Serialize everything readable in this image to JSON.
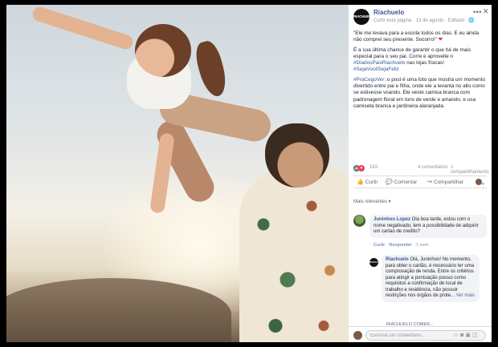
{
  "photo": {},
  "header": {
    "logo_text": "RIACHUELO",
    "page_name": "Riachuelo",
    "meta": "Curtir esta página · 13 de agosto · Editado · 🌐",
    "more_icon": "more-dots-icon",
    "close_icon": "close-icon"
  },
  "post": {
    "p1": "\"Ele me levava para a escola todos os dias. E eu ainda não comprei seu presente. Socorro!\"",
    "p2_a": "É a sua última chance de garantir o que há de mais especial para o seu pai. Corre e aproveite o ",
    "p2_tag1": "#DiadosPaisRiachuelo",
    "p2_b": " nas lojas físicas! ",
    "p2_tag2": "#SejaVocêSejaFeliz",
    "p3_tag": "#PraCegoVer",
    "p3_text": ": o post é uma foto que mostra um momento divertido entre pai e filha, onde ele a levanta no alto como se estivesse voando. Ele veste camisa branca com padronagem floral em tons de verde e amarelo, e usa camiseta branca e jardineira alaranjada."
  },
  "counts": {
    "reactions": "183",
    "comments": "4 comentários",
    "shares": "1 compartilhamento"
  },
  "actions": {
    "like": "Curtir",
    "comment": "Comentar",
    "share": "Compartilhar"
  },
  "relevance": "Mais relevantes ▾",
  "comment1": {
    "name": "Juninhoo Lopez",
    "text": " Ola boa tarde, estou com o nome negativado, tem a possibilidade de adquirir um cartao de credito?",
    "like": "Curtir",
    "reply": "Responder",
    "time": "1 sem"
  },
  "reply": {
    "logo_text": "RIACHUELO",
    "name": "Riachuelo",
    "text": " Olá, Juninhoo! No momento, para obter o cartão, é necessário ter uma comprovação de renda. Entre os critérios para atingir a pontuação possui como requisitos a confirmação de local de trabalho e residência, não possuir restrições nos órgãos de prote...",
    "more": "Ver mais",
    "sub": "RIACHUELO COMER..."
  },
  "composer": {
    "placeholder": "Escreva um comentário...",
    "icons": [
      "emoji-icon",
      "camera-icon",
      "gif-icon",
      "sticker-icon"
    ]
  },
  "colors": {
    "link": "#365899",
    "like_blue": "#4267b2",
    "love_red": "#f33e58"
  }
}
